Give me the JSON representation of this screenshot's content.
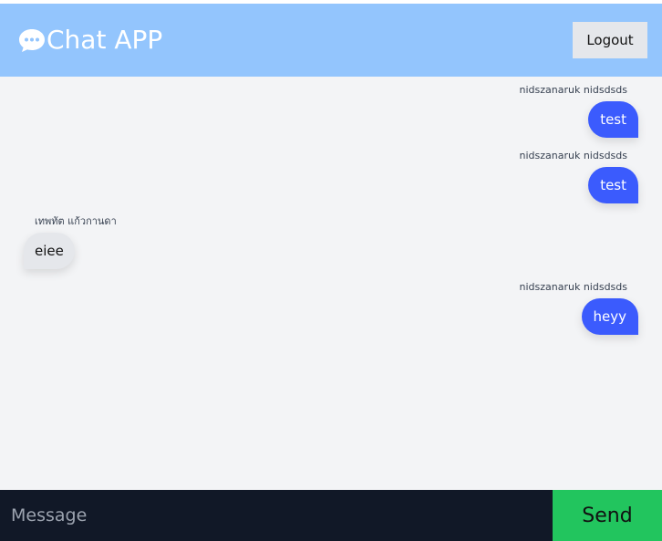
{
  "header": {
    "title": "Chat APP",
    "icon": "chat-bubble-icon",
    "logout_label": "Logout"
  },
  "messages": [
    {
      "sender": "nidszanaruk nidsdsds",
      "text": "test",
      "side": "right"
    },
    {
      "sender": "nidszanaruk nidsdsds",
      "text": "test",
      "side": "right"
    },
    {
      "sender": "เทพทัต แก้วกานดา",
      "text": "eiee",
      "side": "left"
    },
    {
      "sender": "nidszanaruk nidsdsds",
      "text": "heyy",
      "side": "right"
    }
  ],
  "composer": {
    "placeholder": "Message",
    "value": "",
    "send_label": "Send"
  },
  "colors": {
    "header_bg": "#93c5fd",
    "own_bubble": "#3b5bfd",
    "other_bubble": "#e5e7eb",
    "footer_bg": "#111827",
    "send_bg": "#22c55e"
  }
}
